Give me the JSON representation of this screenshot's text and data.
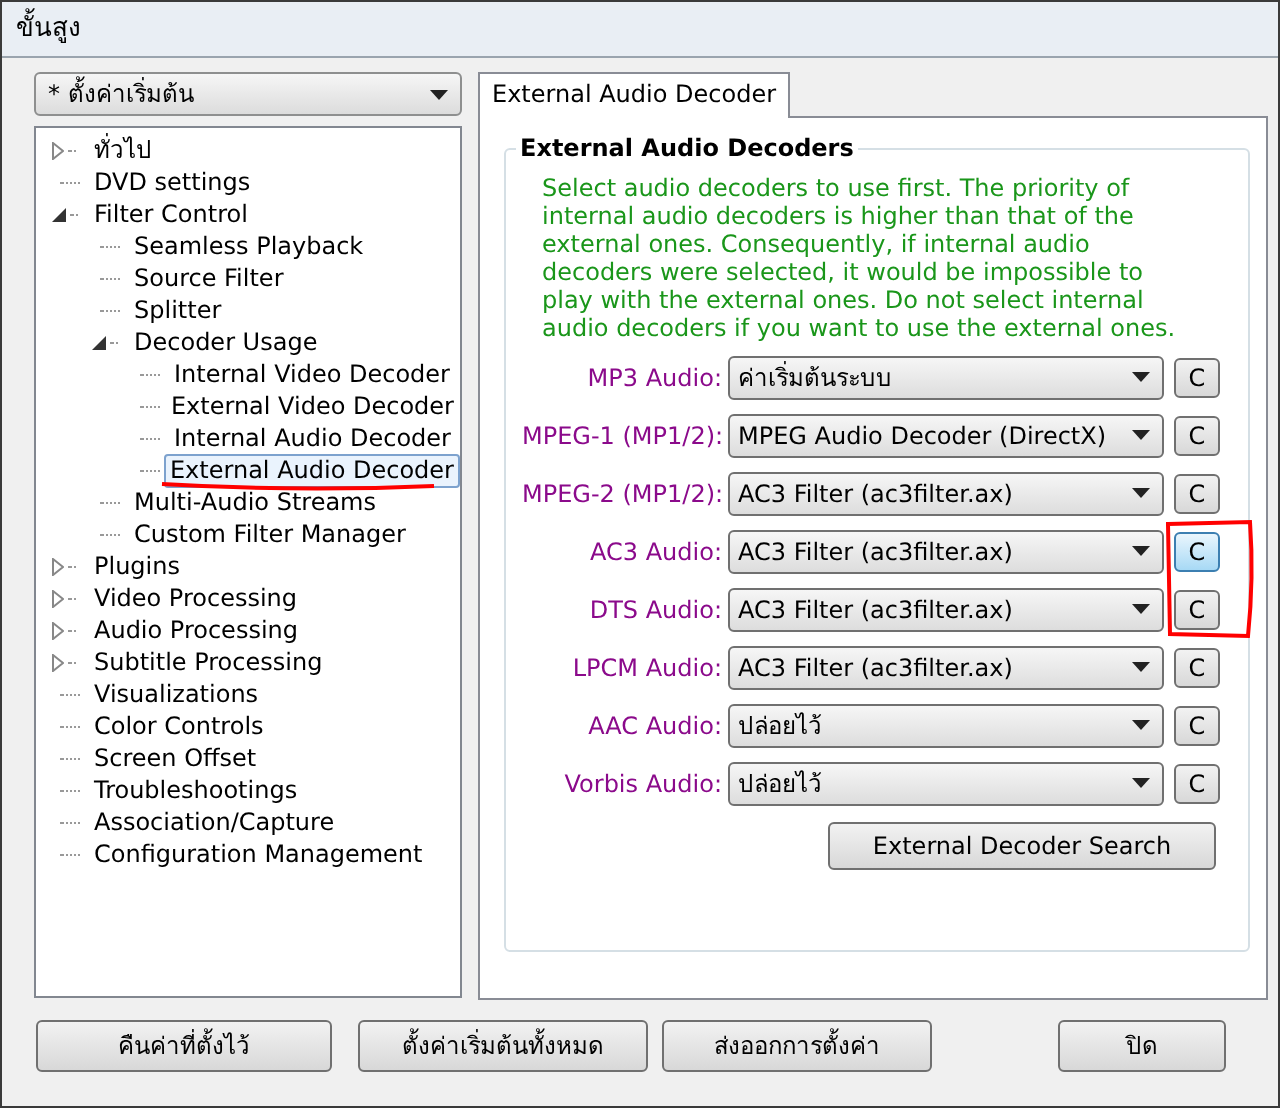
{
  "window": {
    "title": "ขั้นสูง"
  },
  "profile": {
    "value": "* ตั้งค่าเริ่มต้น"
  },
  "tree": [
    {
      "label": "ทั่วไป",
      "kind": "folder",
      "expanded": false,
      "selected": false
    },
    {
      "label": "DVD settings",
      "kind": "leaf",
      "selected": false
    },
    {
      "label": "Filter Control",
      "kind": "folder",
      "expanded": true,
      "selected": false,
      "children": [
        {
          "label": "Seamless Playback",
          "kind": "leaf",
          "selected": false
        },
        {
          "label": "Source Filter",
          "kind": "leaf",
          "selected": false
        },
        {
          "label": "Splitter",
          "kind": "leaf",
          "selected": false
        },
        {
          "label": "Decoder Usage",
          "kind": "folder",
          "expanded": true,
          "selected": false,
          "children": [
            {
              "label": "Internal Video Decoder",
              "kind": "leaf",
              "selected": false
            },
            {
              "label": "External Video Decoder",
              "kind": "leaf",
              "selected": false
            },
            {
              "label": "Internal Audio Decoder",
              "kind": "leaf",
              "selected": false
            },
            {
              "label": "External Audio Decoder",
              "kind": "leaf",
              "selected": true
            }
          ]
        },
        {
          "label": "Multi-Audio Streams",
          "kind": "leaf",
          "selected": false
        },
        {
          "label": "Custom Filter Manager",
          "kind": "leaf",
          "selected": false
        }
      ]
    },
    {
      "label": "Plugins",
      "kind": "folder",
      "expanded": false,
      "selected": false
    },
    {
      "label": "Video Processing",
      "kind": "folder",
      "expanded": false,
      "selected": false
    },
    {
      "label": "Audio Processing",
      "kind": "folder",
      "expanded": false,
      "selected": false
    },
    {
      "label": "Subtitle Processing",
      "kind": "folder",
      "expanded": false,
      "selected": false
    },
    {
      "label": "Visualizations",
      "kind": "leaf",
      "selected": false
    },
    {
      "label": "Color Controls",
      "kind": "leaf",
      "selected": false
    },
    {
      "label": "Screen Offset",
      "kind": "leaf",
      "selected": false
    },
    {
      "label": "Troubleshootings",
      "kind": "leaf",
      "selected": false
    },
    {
      "label": "Association/Capture",
      "kind": "leaf",
      "selected": false
    },
    {
      "label": "Configuration Management",
      "kind": "leaf",
      "selected": false
    }
  ],
  "tabs": [
    {
      "label": "External Audio Decoder",
      "selected": true
    }
  ],
  "group": {
    "title": "External Audio Decoders",
    "description": "Select audio decoders to use first. The priority of internal audio decoders is higher than that of the external ones. Consequently, if internal audio decoders were selected, it would be impossible to play with the external ones. Do not select internal audio decoders if you want to use the external ones.",
    "rows": [
      {
        "label": "MP3 Audio:",
        "value": "ค่าเริ่มต้นระบบ",
        "button": "C",
        "hot": false
      },
      {
        "label": "MPEG-1 (MP1/2):",
        "value": "MPEG Audio Decoder (DirectX)",
        "button": "C",
        "hot": false
      },
      {
        "label": "MPEG-2 (MP1/2):",
        "value": "AC3 Filter (ac3filter.ax)",
        "button": "C",
        "hot": false
      },
      {
        "label": "AC3 Audio:",
        "value": "AC3 Filter (ac3filter.ax)",
        "button": "C",
        "hot": true
      },
      {
        "label": "DTS Audio:",
        "value": "AC3 Filter (ac3filter.ax)",
        "button": "C",
        "hot": false
      },
      {
        "label": "LPCM Audio:",
        "value": "AC3 Filter (ac3filter.ax)",
        "button": "C",
        "hot": false
      },
      {
        "label": "AAC Audio:",
        "value": "ปล่อยไว้",
        "button": "C",
        "hot": false
      },
      {
        "label": "Vorbis Audio:",
        "value": "ปล่อยไว้",
        "button": "C",
        "hot": false
      }
    ],
    "search_button": "External Decoder Search"
  },
  "buttons": [
    "คืนค่าที่ตั้งไว้",
    "ตั้งค่าเริ่มต้นทั้งหมด",
    "ส่งออกการตั้งค่า",
    "ปิด"
  ]
}
